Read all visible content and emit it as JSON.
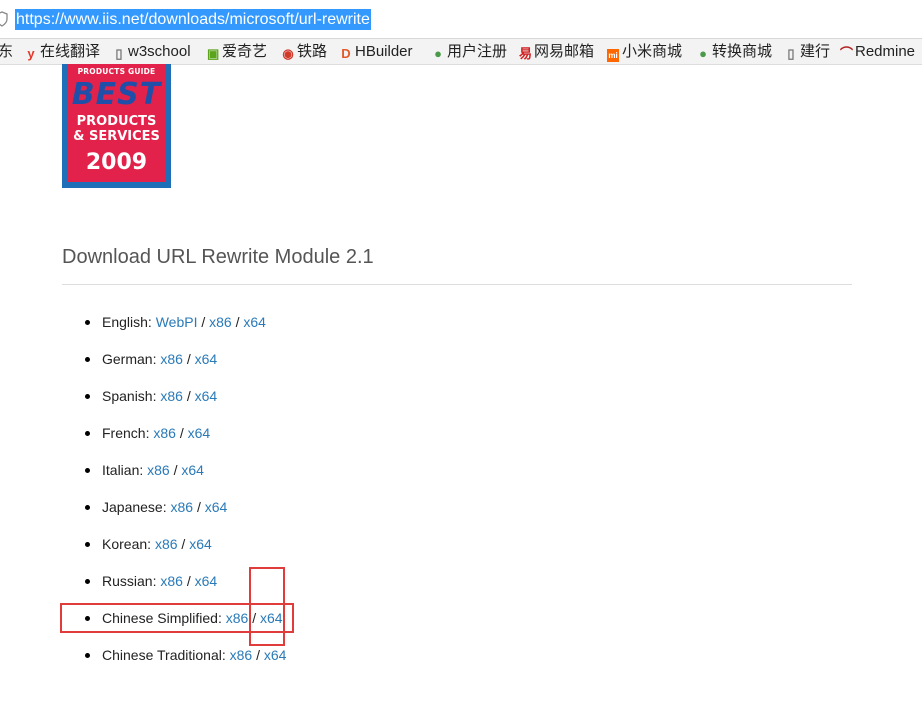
{
  "browser": {
    "url": "https://www.iis.net/downloads/microsoft/url-rewrite",
    "bookmarks": [
      {
        "label": "东",
        "icon": "truncated-bookmark"
      },
      {
        "label": "在线翻译",
        "icon": "youdao-icon",
        "icon_char": "y",
        "icon_color": "#e23a2a"
      },
      {
        "label": "w3school",
        "icon": "page-icon",
        "icon_char": "▯",
        "icon_color": "#777777"
      },
      {
        "label": "爱奇艺",
        "icon": "iqiyi-icon",
        "icon_char": "▣",
        "icon_color": "#5aa31a"
      },
      {
        "label": "铁路",
        "icon": "railway-icon",
        "icon_char": "◉",
        "icon_color": "#d23a2a"
      },
      {
        "label": "HBuilder",
        "icon": "hbuilder-icon",
        "icon_char": "D",
        "icon_color": "#e35a2a"
      },
      {
        "label": "用户注册",
        "icon": "globe-icon",
        "icon_char": "●",
        "icon_color": "#4a9a4a"
      },
      {
        "label": "网易邮箱",
        "icon": "netease-icon",
        "icon_char": "易",
        "icon_color": "#d02020"
      },
      {
        "label": "小米商城",
        "icon": "mi-icon",
        "icon_char": "mi",
        "icon_color": "#ff6700"
      },
      {
        "label": "转换商城",
        "icon": "globe-icon",
        "icon_char": "●",
        "icon_color": "#4a9a4a"
      },
      {
        "label": "建行",
        "icon": "page-icon",
        "icon_char": "▯",
        "icon_color": "#777777"
      },
      {
        "label": "Redmine",
        "icon": "redmine-icon",
        "icon_char": "⌒",
        "icon_color": "#b22222"
      }
    ]
  },
  "badge": {
    "guide": "PRODUCTS GUIDE",
    "best": "BEST",
    "products": "PRODUCTS",
    "services": "& SERVICES",
    "year": "2009"
  },
  "page": {
    "heading": "Download URL Rewrite Module 2.1"
  },
  "downloads": [
    {
      "language": "English:",
      "links": [
        "WebPI",
        "x86",
        "x64"
      ]
    },
    {
      "language": "German:",
      "links": [
        "x86",
        "x64"
      ]
    },
    {
      "language": "Spanish:",
      "links": [
        "x86",
        "x64"
      ]
    },
    {
      "language": "French:",
      "links": [
        "x86",
        "x64"
      ]
    },
    {
      "language": "Italian:",
      "links": [
        "x86",
        "x64"
      ]
    },
    {
      "language": "Japanese:",
      "links": [
        "x86",
        "x64"
      ]
    },
    {
      "language": "Korean:",
      "links": [
        "x86",
        "x64"
      ]
    },
    {
      "language": "Russian:",
      "links": [
        "x86",
        "x64"
      ]
    },
    {
      "language": "Chinese Simplified:",
      "links": [
        "x86",
        "x64"
      ]
    },
    {
      "language": "Chinese Traditional:",
      "links": [
        "x86",
        "x64"
      ]
    }
  ],
  "separator": "/",
  "annotation_color": "#e03c3c"
}
